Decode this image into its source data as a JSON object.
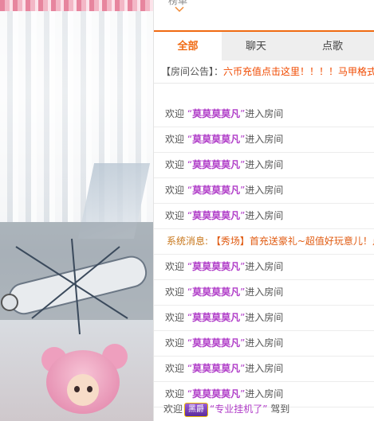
{
  "panel": {
    "top_fragment": "榜单",
    "tabs": [
      {
        "label": "全部",
        "active": true
      },
      {
        "label": "聊天",
        "active": false
      },
      {
        "label": "点歌",
        "active": false
      }
    ],
    "notice": {
      "label": "【房间公告】：",
      "text": "六币充值点击这里！！！！马甲格式"
    },
    "enter_template": {
      "prefix": "欢迎",
      "open_quote": "“",
      "close_quote": "”",
      "suffix": "进入房间"
    },
    "messages": [
      {
        "type": "enter",
        "nickname": "莫莫莫莫凡"
      },
      {
        "type": "enter",
        "nickname": "莫莫莫莫凡"
      },
      {
        "type": "enter",
        "nickname": "莫莫莫莫凡"
      },
      {
        "type": "enter",
        "nickname": "莫莫莫莫凡"
      },
      {
        "type": "enter",
        "nickname": "莫莫莫莫凡"
      },
      {
        "type": "system",
        "label": "系统消息:",
        "text": "【秀场】首充送豪礼~超值好玩意儿！点"
      },
      {
        "type": "enter",
        "nickname": "莫莫莫莫凡"
      },
      {
        "type": "enter",
        "nickname": "莫莫莫莫凡"
      },
      {
        "type": "enter",
        "nickname": "莫莫莫莫凡"
      },
      {
        "type": "enter",
        "nickname": "莫莫莫莫凡"
      },
      {
        "type": "enter",
        "nickname": "莫莫莫莫凡"
      },
      {
        "type": "enter",
        "nickname": "莫莫莫莫凡"
      }
    ],
    "last_message": {
      "prefix": "欢迎",
      "vip_badge": "黑爵",
      "nickname": "“专业挂机了”",
      "action": "驾到"
    }
  },
  "colors": {
    "accent": "#f06a12",
    "nickname": "#b03dc8",
    "notice_link": "#f04a00",
    "system": "#c8761a"
  }
}
